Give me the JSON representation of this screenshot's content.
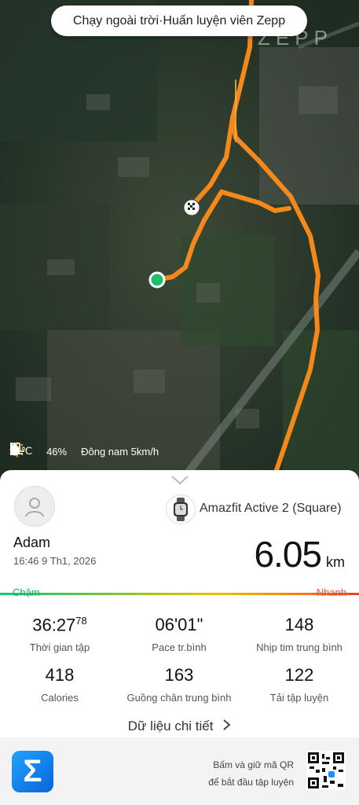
{
  "header": {
    "title": "Chạy ngoài trời·Huấn luyện viên Zepp",
    "watermark": "ZEPP"
  },
  "weather": {
    "temperature": "21℃",
    "humidity": "46%",
    "wind": "Đông nam 5km/h"
  },
  "device": {
    "name": "Amazfit Active 2 (Square)"
  },
  "user": {
    "name": "Adam",
    "datetime": "16:46 9 Th1, 2026"
  },
  "distance": {
    "value": "6.05",
    "unit": "km"
  },
  "pace_scale": {
    "slow": "Chậm",
    "fast": "Nhanh"
  },
  "stats": {
    "time_main": "36:27",
    "time_sup": "78",
    "time_label": "Thời gian tập",
    "pace": "06'01\"",
    "pace_label": "Pace tr.bình",
    "heart": "148",
    "heart_label": "Nhịp tim trung bình",
    "calories": "418",
    "calories_label": "Calories",
    "cadence": "163",
    "cadence_label": "Guồng chân trung bình",
    "load": "122",
    "load_label": "Tải tập luyện"
  },
  "details_link": "Dữ liệu chi tiết",
  "footer": {
    "qr_line1": "Bấm và giữ mã QR",
    "qr_line2": "để bắt đầu tập luyện",
    "app_icon": "Σ"
  },
  "colors": {
    "route": "#ff8c1a",
    "start": "#1fbf6b",
    "slow": "#18b06d",
    "fast": "#e8553a"
  },
  "icons": [
    "sun-icon",
    "humidity-icon",
    "wind-icon",
    "chevron-down-icon",
    "avatar-icon",
    "watch-icon",
    "chevron-right-icon",
    "finish-flag-icon",
    "qr-code"
  ]
}
